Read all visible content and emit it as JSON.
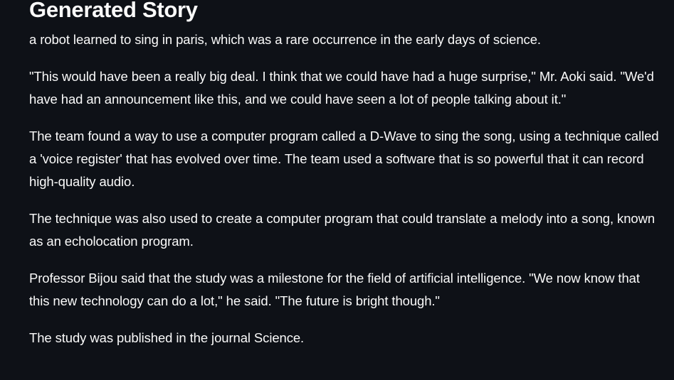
{
  "page": {
    "title": "Generated Story"
  },
  "story": {
    "paragraphs": [
      "a robot learned to sing in paris, which was a rare occurrence in the early days of science.",
      "\"This would have been a really big deal. I think that we could have had a huge surprise,\" Mr. Aoki said. \"We'd have had an announcement like this, and we could have seen a lot of people talking about it.\"",
      "The team found a way to use a computer program called a D-Wave to sing the song, using a technique called a 'voice register' that has evolved over time. The team used a software that is so powerful that it can record high-quality audio.",
      "The technique was also used to create a computer program that could translate a melody into a song, known as an echolocation program.",
      "Professor Bijou said that the study was a milestone for the field of artificial intelligence. \"We now know that this new technology can do a lot,\" he said. \"The future is bright though.\"",
      "The study was published in the journal Science."
    ]
  },
  "colors": {
    "background": "#0e1117",
    "text": "#fafafa"
  }
}
